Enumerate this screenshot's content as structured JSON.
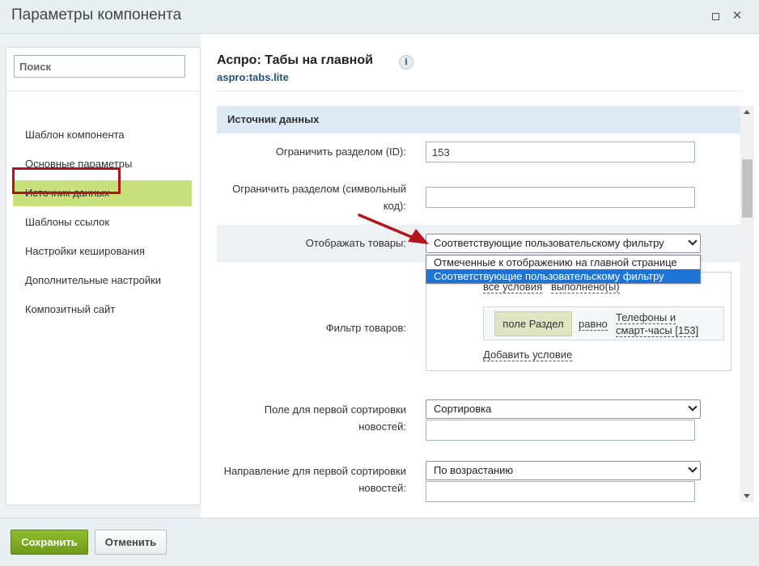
{
  "window": {
    "title": "Параметры компонента"
  },
  "sidebar": {
    "search_placeholder": "Поиск",
    "items": [
      {
        "label": "Шаблон компонента"
      },
      {
        "label": "Основные параметры"
      },
      {
        "label": "Источник данных",
        "active": true
      },
      {
        "label": "Шаблоны ссылок"
      },
      {
        "label": "Настройки кеширования"
      },
      {
        "label": "Дополнительные настройки"
      },
      {
        "label": "Композитный сайт"
      }
    ]
  },
  "component": {
    "title": "Аспро: Табы на главной",
    "code": "aspro:tabs.lite",
    "info_icon": "i"
  },
  "section": {
    "title": "Источник данных",
    "fields": {
      "section_id": {
        "label": "Ограничить разделом (ID):",
        "value": "153"
      },
      "section_code": {
        "label": "Ограничить разделом (символьный код):",
        "value": ""
      },
      "show_products": {
        "label": "Отображать товары:",
        "value": "Соответствующие пользовательскому фильтру",
        "options": [
          "Отмеченные к отображению на главной странице",
          "Соответствующие пользовательскому фильтру"
        ],
        "selected_index": 1
      },
      "filter": {
        "label": "Фильтр товаров:",
        "cond_all": "все условия",
        "cond_state": "выполнено(ы)",
        "condition": {
          "field": "поле Раздел",
          "operator": "равно",
          "value": "Телефоны и смарт-часы [153]"
        },
        "add_condition": "Добавить условие"
      },
      "sort1": {
        "label": "Поле для первой сортировки новостей:",
        "value": "Сортировка"
      },
      "sort1_dir": {
        "label": "Направление для первой сортировки новостей:",
        "value": "По возрастанию"
      }
    }
  },
  "footer": {
    "save": "Сохранить",
    "cancel": "Отменить"
  },
  "colors": {
    "accent_green": "#c8e07b",
    "highlight_red": "#b4141c",
    "section_bg": "#dde9f4",
    "option_selected": "#1e74d6"
  }
}
